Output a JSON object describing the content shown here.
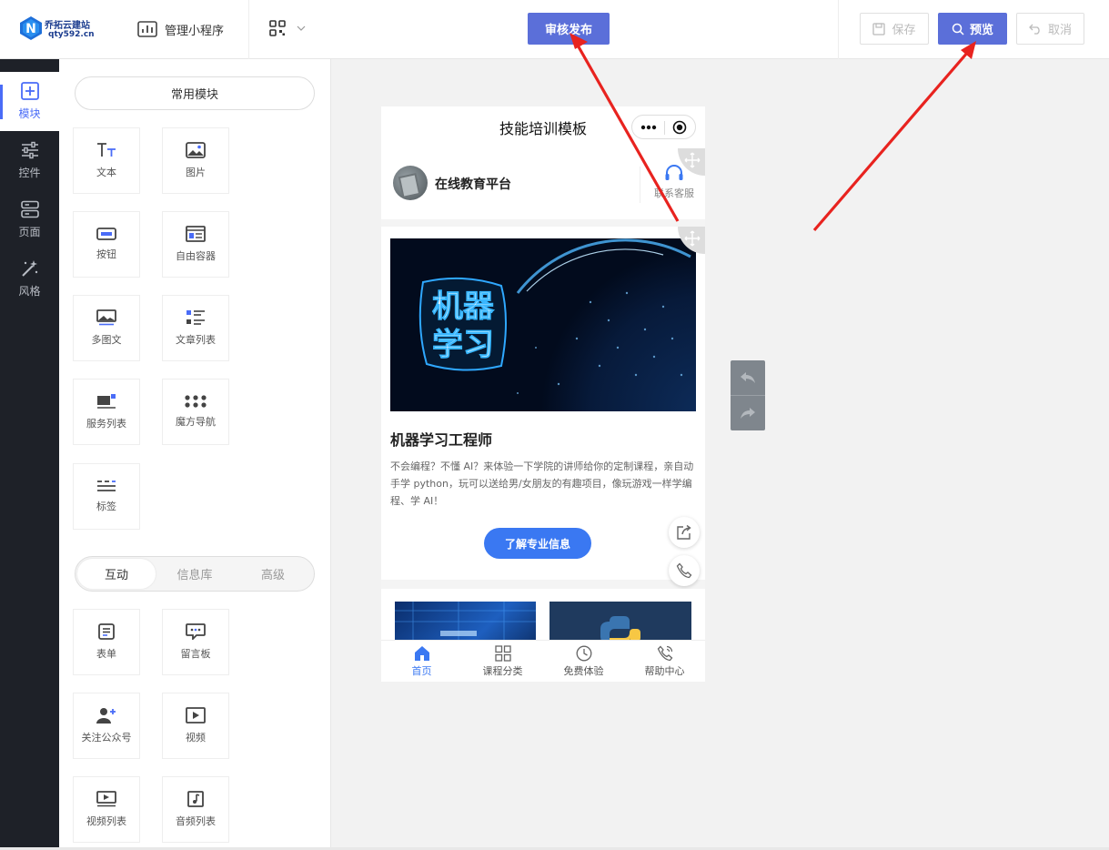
{
  "header": {
    "logo_line1": "乔拓云建站",
    "logo_line2": "qty592.cn",
    "logo_letter": "N",
    "manage_label": "管理小程序",
    "publish_label": "审核发布",
    "save_label": "保存",
    "preview_label": "预览",
    "cancel_label": "取消"
  },
  "sidebar": {
    "items": [
      {
        "label": "模块",
        "icon": "plus-square-icon",
        "active": true
      },
      {
        "label": "控件",
        "icon": "sliders-icon"
      },
      {
        "label": "页面",
        "icon": "pages-icon"
      },
      {
        "label": "风格",
        "icon": "magic-wand-icon"
      }
    ]
  },
  "panel": {
    "common_label": "常用模块",
    "modules": [
      {
        "label": "文本",
        "icon": "text-icon"
      },
      {
        "label": "图片",
        "icon": "image-icon"
      },
      {
        "label": "按钮",
        "icon": "button-icon"
      },
      {
        "label": "自由容器",
        "icon": "container-icon"
      },
      {
        "label": "多图文",
        "icon": "multi-image-text-icon"
      },
      {
        "label": "文章列表",
        "icon": "article-list-icon"
      },
      {
        "label": "服务列表",
        "icon": "service-list-icon"
      },
      {
        "label": "魔方导航",
        "icon": "grid-nav-icon"
      },
      {
        "label": "标签",
        "icon": "tag-icon"
      }
    ],
    "tabs": [
      {
        "label": "互动",
        "active": true
      },
      {
        "label": "信息库"
      },
      {
        "label": "高级"
      }
    ],
    "interactive_modules": [
      {
        "label": "表单",
        "icon": "form-icon"
      },
      {
        "label": "留言板",
        "icon": "message-board-icon"
      },
      {
        "label": "关注公众号",
        "icon": "follow-account-icon"
      },
      {
        "label": "视频",
        "icon": "video-icon"
      },
      {
        "label": "视频列表",
        "icon": "video-list-icon"
      },
      {
        "label": "音频列表",
        "icon": "audio-list-icon"
      }
    ]
  },
  "phone": {
    "title": "技能培训模板",
    "brand": "在线教育平台",
    "service_label": "联系客服",
    "banner_text_line1": "机器",
    "banner_text_line2": "学习",
    "card_title": "机器学习工程师",
    "card_desc": "不会编程？不懂 AI？来体验一下学院的讲师给你的定制课程，亲自动手学 python，玩可以送给男/女朋友的有趣项目，像玩游戏一样学编程、学 AI！",
    "card_button": "了解专业信息",
    "tabbar": [
      {
        "label": "首页",
        "icon": "home-icon",
        "active": true
      },
      {
        "label": "课程分类",
        "icon": "category-grid-icon"
      },
      {
        "label": "免费体验",
        "icon": "clock-icon"
      },
      {
        "label": "帮助中心",
        "icon": "phone-call-icon"
      }
    ]
  },
  "colors": {
    "primary": "#5b6fd9",
    "accent_blue": "#3a78f2",
    "sidebar_bg": "#1e2128",
    "arrow_red": "#e8231f"
  }
}
